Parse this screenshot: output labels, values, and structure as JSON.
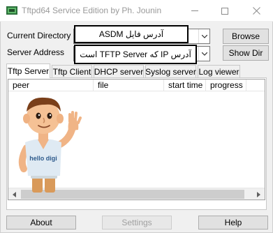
{
  "window": {
    "title": "Tftpd64 Service Edition by Ph. Jounin"
  },
  "form": {
    "current_directory_label": "Current Directory",
    "server_address_label": "Server Address",
    "current_directory_value": "آدرس فایل ASDM",
    "server_address_value": "آدرس IP که TFTP Server است",
    "browse_label": "Browse",
    "show_dir_label": "Show Dir"
  },
  "tabs": [
    {
      "label": "Tftp Server",
      "active": true
    },
    {
      "label": "Tftp Client",
      "active": false
    },
    {
      "label": "DHCP server",
      "active": false
    },
    {
      "label": "Syslog server",
      "active": false
    },
    {
      "label": "Log viewer",
      "active": false
    }
  ],
  "list": {
    "columns": [
      "peer",
      "file",
      "start time",
      "progress"
    ],
    "rows": []
  },
  "mascot": {
    "shirt_text": "hello digi"
  },
  "footer": {
    "about_label": "About",
    "settings_label": "Settings",
    "help_label": "Help"
  },
  "colors": {
    "window_bg": "#f0f0f0",
    "title_text": "#9a9a9a",
    "disabled_text": "#a0a0a0"
  }
}
